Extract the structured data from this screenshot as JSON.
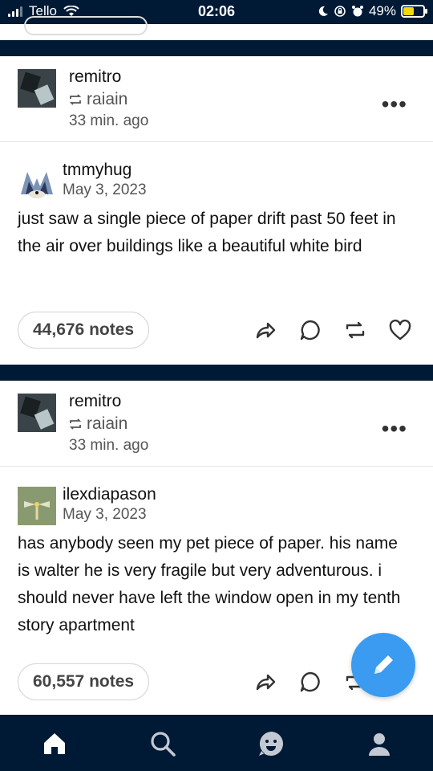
{
  "status_bar": {
    "carrier": "Tello",
    "time": "02:06",
    "battery": "49%"
  },
  "posts": [
    {
      "reblogger": "remitro",
      "reblogged_from": "raiain",
      "time_ago": "33 min. ago",
      "source_user": "tmmyhug",
      "source_date": "May 3, 2023",
      "text": "just saw a single piece of paper drift past 50 feet in the air over buildings like a beautiful white bird",
      "notes": "44,676 notes"
    },
    {
      "reblogger": "remitro",
      "reblogged_from": "raiain",
      "time_ago": "33 min. ago",
      "source_user": "ilexdiapason",
      "source_date": "May 3, 2023",
      "text": "has anybody seen my pet piece of paper. his name is walter he is very fragile but very adventurous. i should never have left the window open in my tenth story apartment",
      "notes": "60,557 notes"
    }
  ],
  "icons": {
    "more": "more-dots-icon",
    "share": "share-icon",
    "reply": "reply-icon",
    "reblog": "reblog-icon",
    "like": "heart-icon",
    "compose": "pencil-icon",
    "nav": [
      "home-icon",
      "search-icon",
      "activity-face-icon",
      "account-icon"
    ]
  },
  "colors": {
    "background": "#001935",
    "fab": "#3a9bf0",
    "battery": "#f5d90a"
  }
}
